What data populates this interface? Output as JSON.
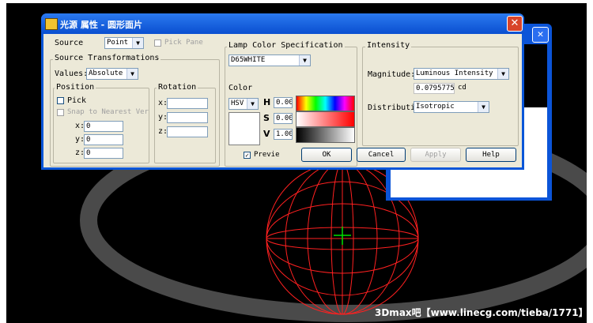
{
  "dialog": {
    "title": "光源 属性 - 圆形面片",
    "close_glyph": "✕",
    "source_label": "Source",
    "source_value": "Point",
    "pick_pane_label": "Pick Pane",
    "source_transformations": {
      "title": "Source Transformations",
      "values_label": "Values:",
      "values_value": "Absolute",
      "position": {
        "title": "Position",
        "pick_label": "Pick",
        "snap_label": "Snap to Nearest Ver",
        "x_label": "x:",
        "x_value": "0",
        "y_label": "y:",
        "y_value": "0",
        "z_label": "z:",
        "z_value": "0"
      },
      "rotation": {
        "title": "Rotation",
        "x_label": "x:",
        "x_value": "",
        "y_label": "y:",
        "y_value": "",
        "z_label": "z:",
        "z_value": ""
      }
    },
    "lamp": {
      "title": "Lamp Color Specification",
      "preset": "D65WHITE",
      "color_label": "Color",
      "mode": "HSV",
      "h_label": "H",
      "h_value": "0.00",
      "s_label": "S",
      "s_value": "0.00",
      "v_label": "V",
      "v_value": "1.00"
    },
    "intensity": {
      "title": "Intensity",
      "magnitude_label": "Magnitude:",
      "magnitude_type": "Luminous Intensity",
      "magnitude_value": "0.0795775",
      "unit": "cd",
      "distribution_label": "Distributi",
      "distribution_value": "Isotropic"
    },
    "preview_label": "Previe",
    "buttons": {
      "ok": "OK",
      "cancel": "Cancel",
      "apply": "Apply",
      "help": "Help"
    }
  },
  "background_window": {
    "close_glyph": "✕"
  },
  "watermark": "3Dmax吧【www.linecg.com/tieba/1771】",
  "icons": {
    "dropdown": "▼",
    "check": "✓"
  }
}
